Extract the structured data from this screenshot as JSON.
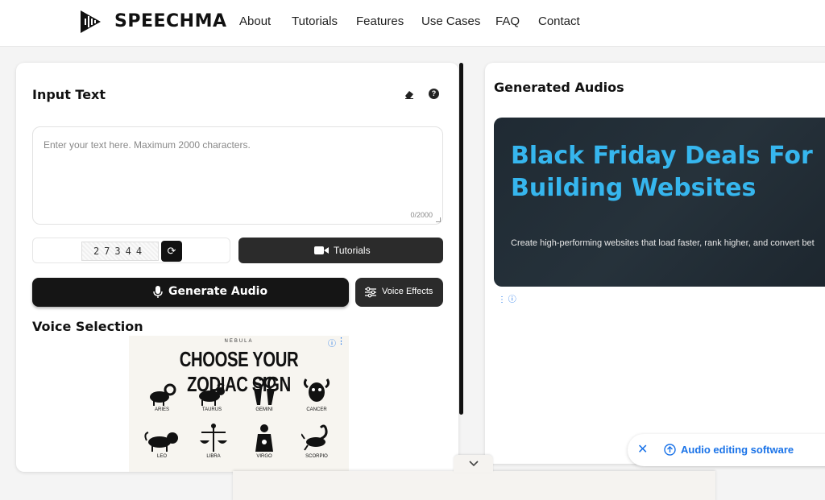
{
  "brand": {
    "name": "SPEECHMA"
  },
  "nav": {
    "about": "About",
    "tutorials": "Tutorials",
    "features": "Features",
    "use_cases": "Use Cases",
    "faq": "FAQ",
    "contact": "Contact"
  },
  "input": {
    "title": "Input Text",
    "placeholder": "Enter your text here. Maximum 2000 characters.",
    "counter": "0/2000",
    "help": "?",
    "eraser_icon": "eraser-icon"
  },
  "captcha": {
    "code": "27344",
    "refresh_icon": "refresh-icon"
  },
  "buttons": {
    "tutorials": "Tutorials",
    "generate": "Generate Audio",
    "voice_effects": "Voice Effects"
  },
  "voice": {
    "title": "Voice Selection"
  },
  "zodiac_ad": {
    "brand": "NEBULA",
    "headline": "CHOOSE YOUR ZODIAC SIGN",
    "signs": [
      "ARIES",
      "TAURUS",
      "GEMINI",
      "CANCER",
      "LEO",
      "LIBRA",
      "VIRGO",
      "SCORPIO"
    ]
  },
  "output": {
    "title": "Generated Audios"
  },
  "banner_ad": {
    "headline": "Black Friday Deals For Building Websites",
    "subtext": "Create high-performing websites that load faster, rank higher, and convert bet"
  },
  "pill": {
    "label": "Audio editing software"
  },
  "colors": {
    "accent_blue": "#1a73e8",
    "banner_text": "#36b6ee",
    "button_dark": "#2b2b2b"
  }
}
